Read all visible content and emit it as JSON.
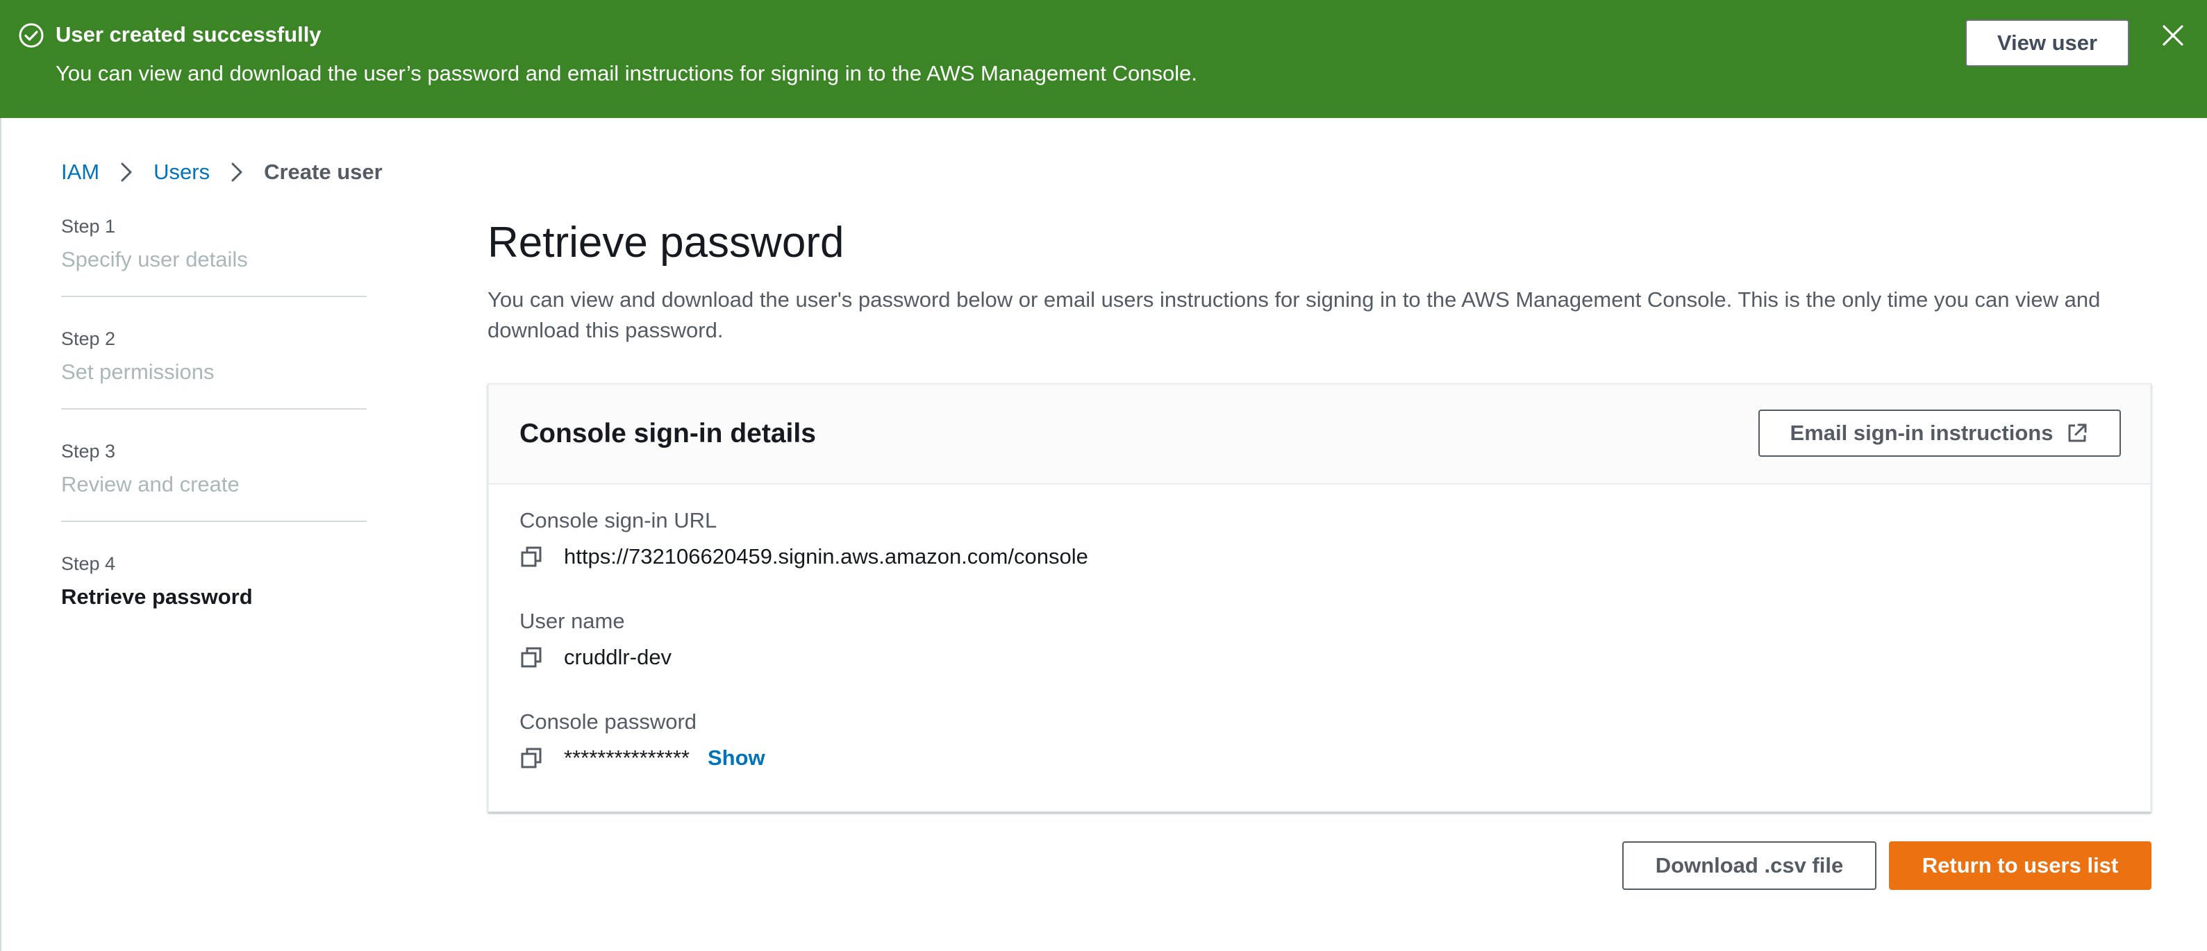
{
  "flash": {
    "title": "User created successfully",
    "message": "You can view and download the user’s password and email instructions for signing in to the AWS Management Console.",
    "view_user_label": "View user",
    "status_icon": "check-circle-icon",
    "dismiss_icon": "close-icon",
    "color": "#3b8526"
  },
  "breadcrumb": {
    "items": [
      "IAM",
      "Users"
    ],
    "current": "Create user",
    "separator_icon": "chevron-right-icon"
  },
  "steps": [
    {
      "number": "Step 1",
      "label": "Specify user details",
      "state": "disabled"
    },
    {
      "number": "Step 2",
      "label": "Set permissions",
      "state": "disabled"
    },
    {
      "number": "Step 3",
      "label": "Review and create",
      "state": "disabled"
    },
    {
      "number": "Step 4",
      "label": "Retrieve password",
      "state": "active"
    }
  ],
  "main": {
    "title": "Retrieve password",
    "description": "You can view and download the user's password below or email users instructions for signing in to the AWS Management Console. This is the only time you can view and download this password."
  },
  "panel": {
    "title": "Console sign-in details",
    "email_button_label": "Email sign-in instructions",
    "email_button_icon": "external-link-icon",
    "fields": {
      "url": {
        "label": "Console sign-in URL",
        "value": "https://732106620459.signin.aws.amazon.com/console"
      },
      "username": {
        "label": "User name",
        "value": "cruddlr-dev"
      },
      "password": {
        "label": "Console password",
        "value": "***************",
        "show_label": "Show"
      }
    },
    "copy_icon": "copy-icon"
  },
  "footer": {
    "download_label": "Download .csv file",
    "return_label": "Return to users list"
  },
  "colors": {
    "link": "#0073bb",
    "primary_button": "#ec7211",
    "success": "#3b8526"
  }
}
